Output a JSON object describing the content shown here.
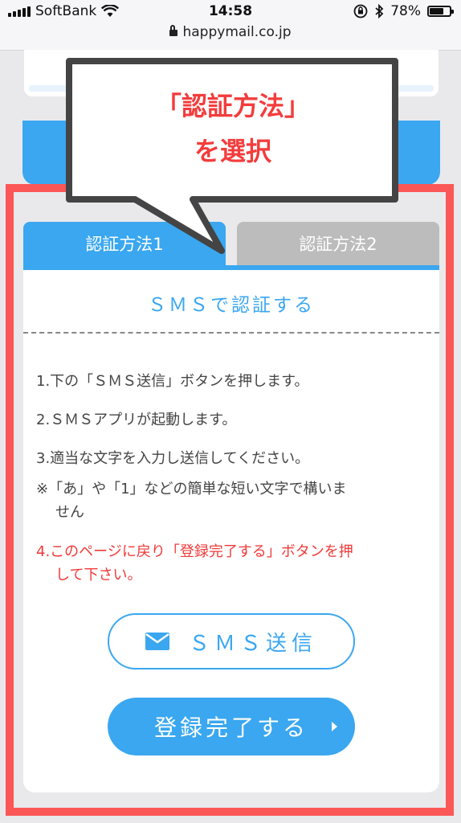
{
  "status_bar": {
    "carrier": "SoftBank",
    "time": "14:58",
    "battery_percent": "78%",
    "battery_level": 0.78,
    "url": "happymail.co.jp"
  },
  "callout": {
    "line1": "「認証方法」",
    "line2": "を選択"
  },
  "tabs": [
    {
      "label": "認証方法1",
      "selected": true
    },
    {
      "label": "認証方法2",
      "selected": false
    }
  ],
  "card": {
    "title": "ＳＭＳで認証する",
    "steps": [
      "1.下の「ＳＭＳ送信」ボタンを押します。",
      "2.ＳＭＳアプリが起動します。",
      "3.適当な文字を入力し送信してください。"
    ],
    "note_line1": "※「あ」や「1」などの簡単な短い文字で構いま",
    "note_line2": "せん",
    "step4_line1": "4.このページに戻り「登録完了する」ボタンを押",
    "step4_line2": "して下さい。"
  },
  "buttons": {
    "sms": "ＳＭＳ送信",
    "complete": "登録完了する"
  },
  "colors": {
    "accent": "#3aa7f0",
    "highlight": "#fb5757",
    "warning_text": "#f03a3a"
  }
}
